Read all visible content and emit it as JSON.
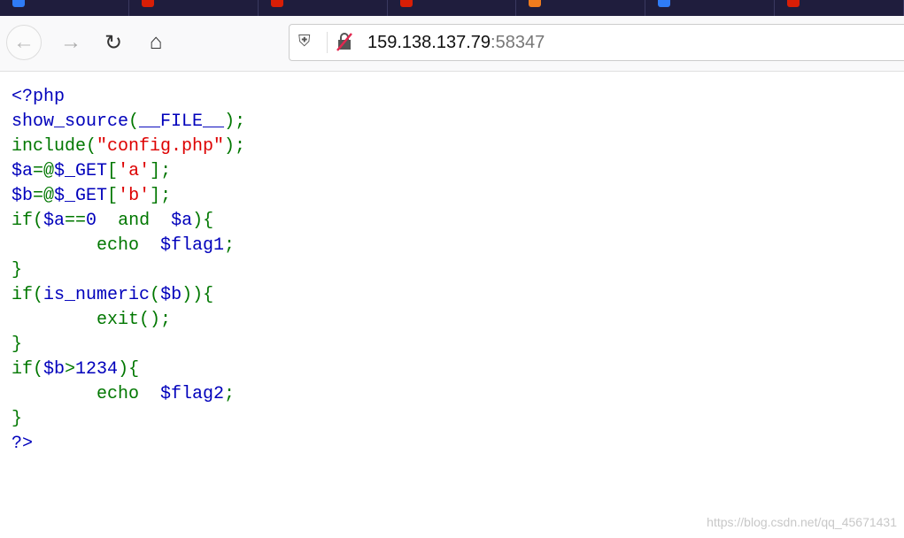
{
  "tabs": [
    {
      "favicon_color": "#2f7cf6"
    },
    {
      "favicon_color": "#d81e06"
    },
    {
      "favicon_color": "#d81e06"
    },
    {
      "favicon_color": "#d81e06"
    },
    {
      "favicon_color": "#f07c1e"
    },
    {
      "favicon_color": "#2f7cf6"
    },
    {
      "favicon_color": "#d81e06"
    }
  ],
  "nav": {
    "back_icon": "arrow-left",
    "forward_icon": "arrow-right",
    "reload_icon": "reload",
    "home_icon": "home"
  },
  "url": {
    "host": "159.138.137.79",
    "port": ":58347"
  },
  "colors": {
    "default": "#0000BB",
    "keyword": "#007700",
    "string": "#DD0000"
  },
  "code": [
    [
      [
        "d",
        "<?php"
      ]
    ],
    [
      [
        "d",
        "show_source"
      ],
      [
        "k",
        "("
      ],
      [
        "d",
        "__FILE__"
      ],
      [
        "k",
        ");"
      ]
    ],
    [
      [
        "k",
        "include("
      ],
      [
        "s",
        "\"config.php\""
      ],
      [
        "k",
        ");"
      ]
    ],
    [
      [
        "d",
        "$a"
      ],
      [
        "k",
        "=@"
      ],
      [
        "d",
        "$_GET"
      ],
      [
        "k",
        "["
      ],
      [
        "s",
        "'a'"
      ],
      [
        "k",
        "];"
      ]
    ],
    [
      [
        "d",
        "$b"
      ],
      [
        "k",
        "=@"
      ],
      [
        "d",
        "$_GET"
      ],
      [
        "k",
        "["
      ],
      [
        "s",
        "'b'"
      ],
      [
        "k",
        "];"
      ]
    ],
    [
      [
        "k",
        "if("
      ],
      [
        "d",
        "$a"
      ],
      [
        "k",
        "=="
      ],
      [
        "d",
        "0"
      ],
      [
        "k",
        "  and  "
      ],
      [
        "d",
        "$a"
      ],
      [
        "k",
        "){"
      ]
    ],
    [
      [
        "k",
        "        echo  "
      ],
      [
        "d",
        "$flag1"
      ],
      [
        "k",
        ";"
      ]
    ],
    [
      [
        "k",
        "}"
      ]
    ],
    [
      [
        "k",
        "if("
      ],
      [
        "d",
        "is_numeric"
      ],
      [
        "k",
        "("
      ],
      [
        "d",
        "$b"
      ],
      [
        "k",
        ")){"
      ]
    ],
    [
      [
        "k",
        "        exit();"
      ]
    ],
    [
      [
        "k",
        "}"
      ]
    ],
    [
      [
        "k",
        "if("
      ],
      [
        "d",
        "$b"
      ],
      [
        "k",
        ">"
      ],
      [
        "d",
        "1234"
      ],
      [
        "k",
        "){"
      ]
    ],
    [
      [
        "k",
        "        echo  "
      ],
      [
        "d",
        "$flag2"
      ],
      [
        "k",
        ";"
      ]
    ],
    [
      [
        "k",
        "}"
      ]
    ],
    [
      [
        "d",
        "?>"
      ]
    ]
  ],
  "watermark": "https://blog.csdn.net/qq_45671431"
}
